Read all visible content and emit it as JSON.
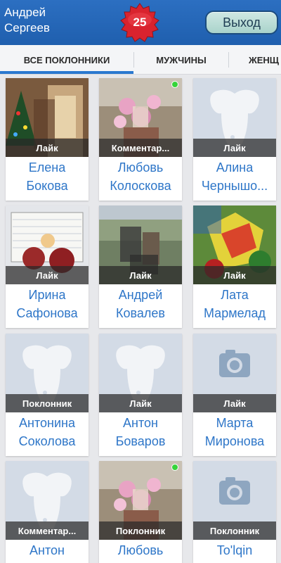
{
  "header": {
    "user_first": "Андрей",
    "user_last": "Сергеев",
    "badge_count": "25",
    "logout_label": "Выход"
  },
  "tabs": [
    {
      "label": "ВСЕ ПОКЛОННИКИ",
      "active": true
    },
    {
      "label": "МУЖЧИНЫ",
      "active": false
    },
    {
      "label": "ЖЕНЩ",
      "active": false
    }
  ],
  "colors": {
    "header": "#2069b6",
    "badge": "#d9232e",
    "accent": "#2a78cf",
    "name_text": "#2e76c8",
    "online": "#36d43a"
  },
  "cards": [
    {
      "line1": "Елена",
      "line2": "Бокова",
      "label": "Лайк",
      "photo": "christmas-room-photo",
      "online": false
    },
    {
      "line1": "Любовь",
      "line2": "Колоскова",
      "label": "Комментар...",
      "photo": "flowers-photo",
      "online": true
    },
    {
      "line1": "Алина",
      "line2": "Чернышо...",
      "label": "Лайк",
      "photo": "dog-placeholder",
      "online": false
    },
    {
      "line1": "Ирина",
      "line2": "Сафонова",
      "label": "Лайк",
      "photo": "notebook-photo",
      "online": false
    },
    {
      "line1": "Андрей",
      "line2": "Ковалев",
      "label": "Лайк",
      "photo": "outdoor-photo",
      "online": false
    },
    {
      "line1": "Лата",
      "line2": "Мармелад",
      "label": "Лайк",
      "photo": "colorful-art-photo",
      "online": false
    },
    {
      "line1": "Антонина",
      "line2": "Соколова",
      "label": "Поклонник",
      "photo": "dog-placeholder",
      "online": false
    },
    {
      "line1": "Антон",
      "line2": "Боваров",
      "label": "Лайк",
      "photo": "dog-placeholder",
      "online": false
    },
    {
      "line1": "Марта",
      "line2": "Миронова",
      "label": "Лайк",
      "photo": "camera-placeholder",
      "online": false
    },
    {
      "line1": "Антон",
      "line2": "",
      "label": "Комментар...",
      "photo": "dog-placeholder",
      "online": false
    },
    {
      "line1": "Любовь",
      "line2": "",
      "label": "Поклонник",
      "photo": "flowers-photo",
      "online": true
    },
    {
      "line1": "To'lqin",
      "line2": "",
      "label": "Поклонник",
      "photo": "camera-placeholder",
      "online": false
    }
  ]
}
